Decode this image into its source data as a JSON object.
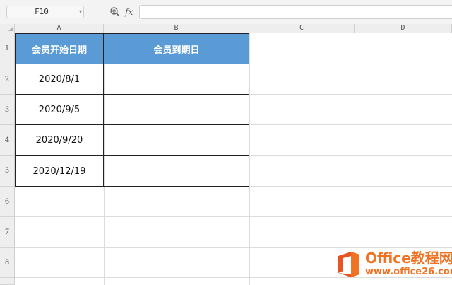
{
  "formula_bar": {
    "name_box": "F10",
    "fx_label": "fx",
    "formula": ""
  },
  "columns": [
    "A",
    "B",
    "C",
    "D"
  ],
  "rows": [
    "1",
    "2",
    "3",
    "4",
    "5",
    "6",
    "7",
    "8"
  ],
  "table": {
    "headers": [
      "会员开始日期",
      "会员到期日"
    ],
    "rows": [
      [
        "2020/8/1",
        ""
      ],
      [
        "2020/9/5",
        ""
      ],
      [
        "2020/9/20",
        ""
      ],
      [
        "2020/12/19",
        ""
      ]
    ]
  },
  "colors": {
    "header_fill": "#5b9bd5",
    "header_text": "#ffffff",
    "watermark": "#f07323"
  },
  "watermark": {
    "title": "Office教程网",
    "url": "www.office26.com",
    "logo_icon": "office-logo-icon"
  }
}
